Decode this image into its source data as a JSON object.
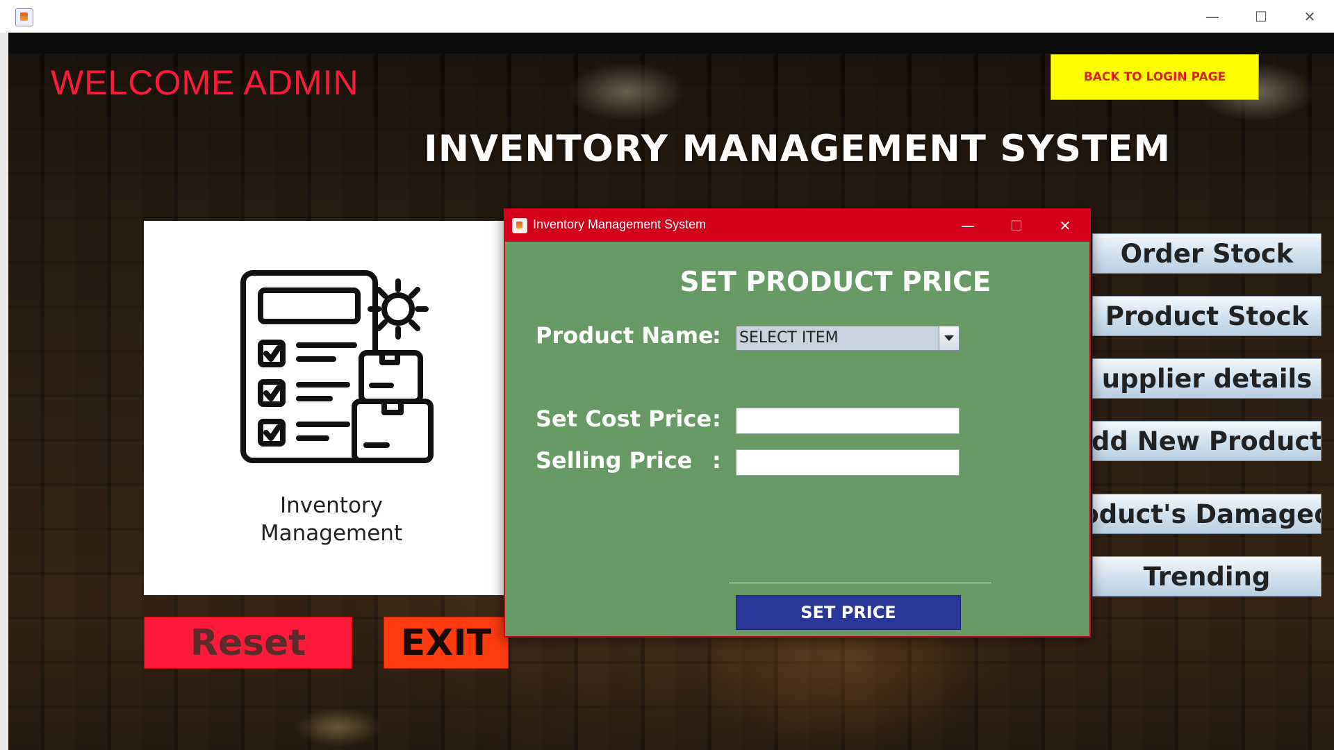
{
  "window": {
    "controls": {
      "minimize": "—",
      "maximize": "☐",
      "close": "✕"
    }
  },
  "main": {
    "welcome": "WELCOME ADMIN",
    "back_button": "BACK TO LOGIN PAGE",
    "title": "INVENTORY MANAGEMENT SYSTEM",
    "logo_caption_line1": "Inventory",
    "logo_caption_line2": "Management",
    "reset_button": "Reset",
    "exit_button": "EXIT",
    "side_buttons": [
      {
        "label": "Order Stock"
      },
      {
        "label": "Product Stock"
      },
      {
        "label": "upplier details"
      },
      {
        "label": "dd New Product"
      },
      {
        "label": "oduct's Damaged"
      },
      {
        "label": "Trending"
      }
    ]
  },
  "dialog": {
    "title": "Inventory Management System",
    "controls": {
      "minimize": "—",
      "maximize": "☐",
      "close": "✕"
    },
    "heading": "SET PRODUCT PRICE",
    "product_name_label": "Product Name",
    "product_name_value": "SELECT ITEM",
    "cost_price_label": "Set Cost Price",
    "cost_price_value": "",
    "selling_price_label": "Selling Price",
    "selling_price_value": "",
    "colon": ":",
    "set_price_button": "SET PRICE"
  },
  "colors": {
    "welcome": "#ff1a3c",
    "back_button_bg": "#ffff00",
    "dialog_bg": "#679a64",
    "dialog_titlebar": "#d4001a",
    "set_price_bg": "#2b3796",
    "reset_bg": "#ff1a3c",
    "exit_bg": "#ff3b10"
  },
  "icons": [
    "app-icon",
    "inventory-checklist-icon",
    "gear-icon",
    "box-icon",
    "dropdown-arrow-icon"
  ]
}
